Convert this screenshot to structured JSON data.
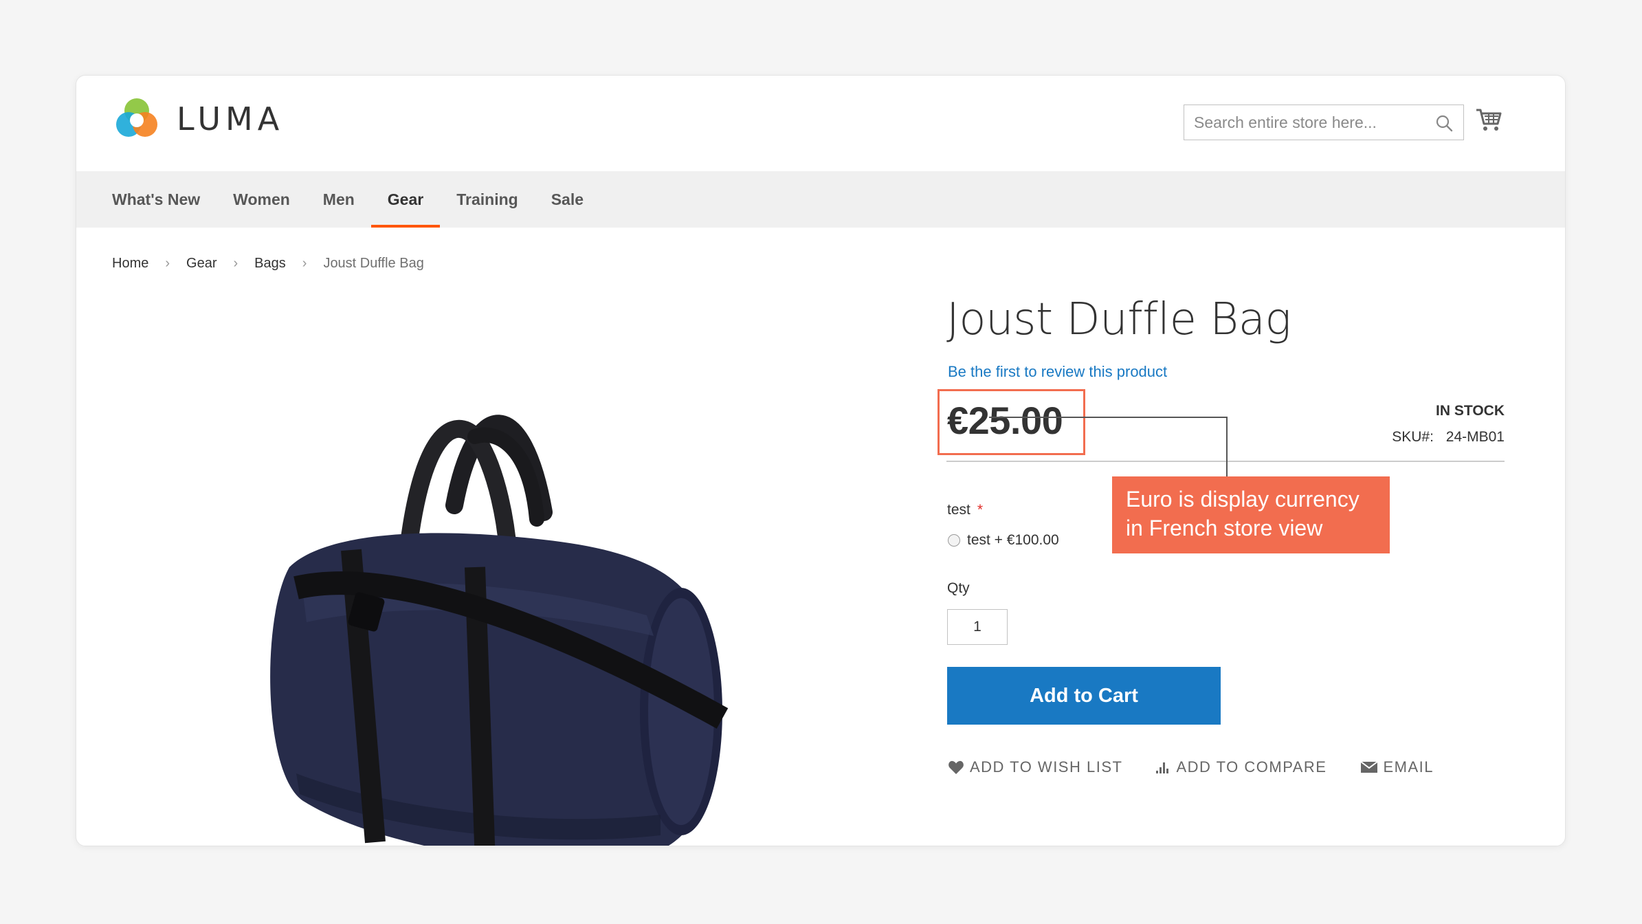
{
  "brand": {
    "name": "LUMA"
  },
  "search": {
    "placeholder": "Search entire store here..."
  },
  "nav": {
    "items": [
      "What's New",
      "Women",
      "Men",
      "Gear",
      "Training",
      "Sale"
    ],
    "active": "Gear"
  },
  "breadcrumb": {
    "items": [
      "Home",
      "Gear",
      "Bags"
    ],
    "current": "Joust Duffle Bag"
  },
  "product": {
    "title": "Joust Duffle Bag",
    "review_link": "Be the first to review this product",
    "price": "€25.00",
    "stock": "IN STOCK",
    "sku_label": "SKU#:",
    "sku": "24-MB01",
    "option_label": "test",
    "option_required": "*",
    "option_value": "test + €100.00",
    "qty_label": "Qty",
    "qty_value": "1",
    "add_to_cart": "Add to Cart"
  },
  "actions": {
    "wishlist": "ADD TO WISH LIST",
    "compare": "ADD TO COMPARE",
    "email": "EMAIL"
  },
  "annotation": {
    "line1": "Euro is display currency",
    "line2": "in French store view"
  },
  "colors": {
    "accent": "#ff5501",
    "link": "#1979c3",
    "callout": "#f26d4f",
    "button": "#1979c3"
  },
  "icons": [
    "luma-logo-icon",
    "search-icon",
    "cart-icon",
    "heart-icon",
    "compare-icon",
    "envelope-icon"
  ]
}
